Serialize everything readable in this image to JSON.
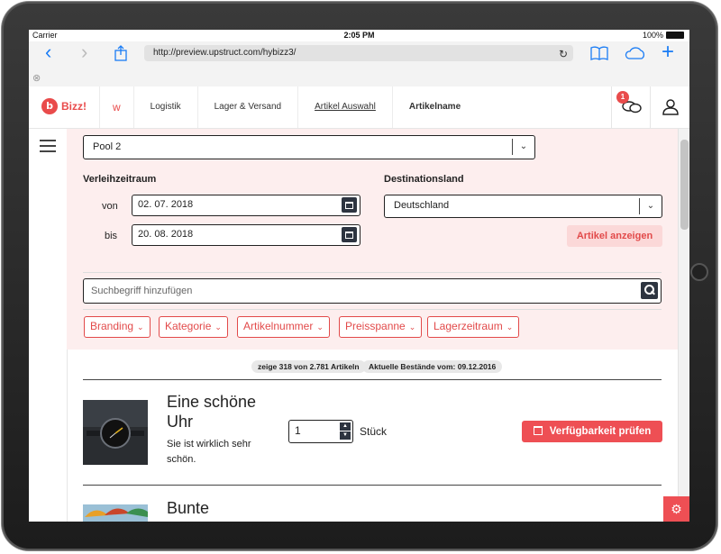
{
  "status": {
    "carrier": "Carrier",
    "time": "2:05 PM",
    "battery": "100%"
  },
  "browser": {
    "url": "http://preview.upstruct.com/hybizz3/"
  },
  "app": {
    "logo_mark": "b",
    "logo_text": "Bizz!",
    "notification_count": "1"
  },
  "breadcrumb": [
    "Logistik",
    "Lager & Versand",
    "Artikel Auswahl",
    "Artikelname"
  ],
  "filters": {
    "pool": "Pool 2",
    "period_label": "Verleihzeitraum",
    "from_label": "von",
    "from_value": "02. 07. 2018",
    "to_label": "bis",
    "to_value": "20. 08. 2018",
    "destination_label": "Destinationsland",
    "destination_value": "Deutschland",
    "show_button": "Artikel anzeigen",
    "search_placeholder": "Suchbegriff hinzufügen",
    "chips": [
      "Branding",
      "Kategorie",
      "Artikelnummer",
      "Preisspanne",
      "Lagerzeitraum"
    ]
  },
  "results": {
    "count": "zeige 318 von 2.781 Artikeln",
    "stock_date": "Aktuelle Bestände vom: 09.12.2016",
    "items": [
      {
        "title_line1": "Eine schöne",
        "title_line2": "Uhr",
        "desc_line1": "Sie ist wirklich sehr",
        "desc_line2": "schön.",
        "quantity": "1",
        "unit": "Stück",
        "action": "Verfügbarkeit prüfen"
      },
      {
        "title_line1": "Bunte"
      }
    ]
  },
  "colors": {
    "brand": "#e94b4b",
    "panel": "#fdeeee",
    "dark_button": "#2d3440"
  }
}
